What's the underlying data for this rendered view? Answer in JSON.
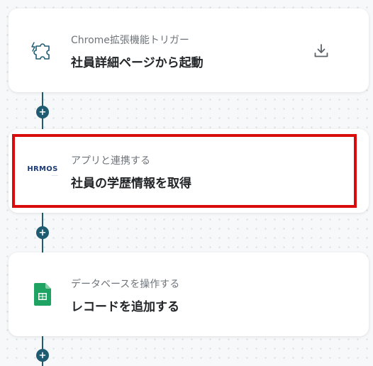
{
  "steps": [
    {
      "subtitle": "Chrome拡張機能トリガー",
      "title": "社員詳細ページから起動",
      "icon": "puzzle-icon",
      "action_icon": "download-icon"
    },
    {
      "subtitle": "アプリと連携する",
      "title": "社員の学歴情報を取得",
      "icon": "hrmos-logo",
      "logo_text": "HRMOS"
    },
    {
      "subtitle": "データベースを操作する",
      "title": "レコードを追加する",
      "icon": "google-sheets-icon"
    }
  ],
  "add_button_label": "+",
  "colors": {
    "connector": "#1f5c72",
    "highlight": "#d90c0c",
    "sheets_green": "#1ea362",
    "hrmos_blue": "#1c3a74"
  }
}
